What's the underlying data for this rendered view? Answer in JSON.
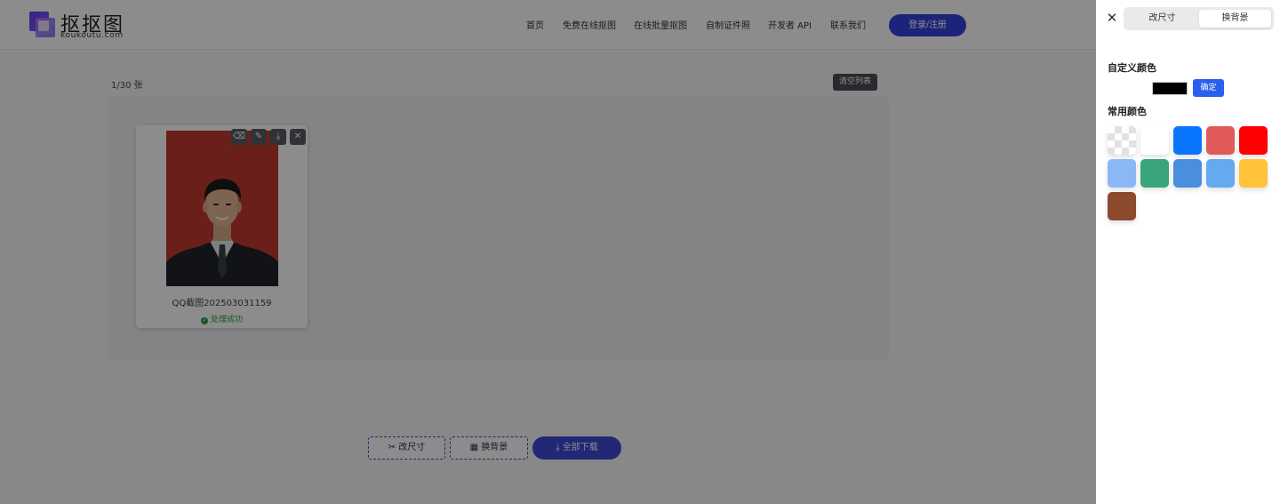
{
  "header": {
    "logo_title": "抠抠图",
    "logo_sub": "koukoutu.com",
    "nav": [
      "首页",
      "免费在线抠图",
      "在线批量抠图",
      "自制证件照",
      "开发者 API",
      "联系我们"
    ],
    "login_label": "登录/注册"
  },
  "main": {
    "count": "1/30 张",
    "clear_label": "清空列表",
    "card": {
      "filename": "QQ截图202503031159",
      "status": "处理成功",
      "bg_color": "#c43a31"
    },
    "buttons": {
      "resize": "改尺寸",
      "change_bg": "换背景",
      "download_all": "全部下载"
    }
  },
  "drawer": {
    "tabs": [
      "改尺寸",
      "换背景"
    ],
    "active_tab": "换背景",
    "custom_title": "自定义颜色",
    "custom_value": "#000000",
    "confirm_label": "确定",
    "common_title": "常用颜色",
    "colors": [
      "transparent",
      "#ffffff",
      "#0a75ff",
      "#e05a5a",
      "#ff0000",
      "#8bb8f5",
      "#3aa57a",
      "#4a8fde",
      "#63aaee",
      "#ffc23a",
      "#8b4a2b"
    ]
  },
  "accent": "#3541dd"
}
